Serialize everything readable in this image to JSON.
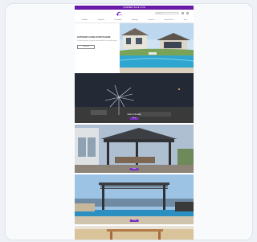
{
  "promo": {
    "text": "SUMMER SALE LIVE"
  },
  "header": {
    "search_placeholder": "Search"
  },
  "nav": {
    "items": [
      "Gazebos",
      "Pergolas",
      "Umbrellas",
      "Awnings",
      "Furniture",
      "Accessories",
      "Sale"
    ]
  },
  "hero": {
    "title": "OUTDOOR LIVING STARTS HERE",
    "subtitle": "Premium gazebos, pergolas and umbrellas for every backyard.",
    "button": "Shop Now"
  },
  "sections": [
    {
      "name": "umbrella",
      "title": "Patio Umbrellas",
      "button": "Shop"
    },
    {
      "name": "gazebo",
      "title": "",
      "button": "Shop"
    },
    {
      "name": "pergola",
      "title": "",
      "button": "Shop"
    }
  ],
  "colors": {
    "brand": "#6a1aa8",
    "label": "#7a2fbf"
  }
}
